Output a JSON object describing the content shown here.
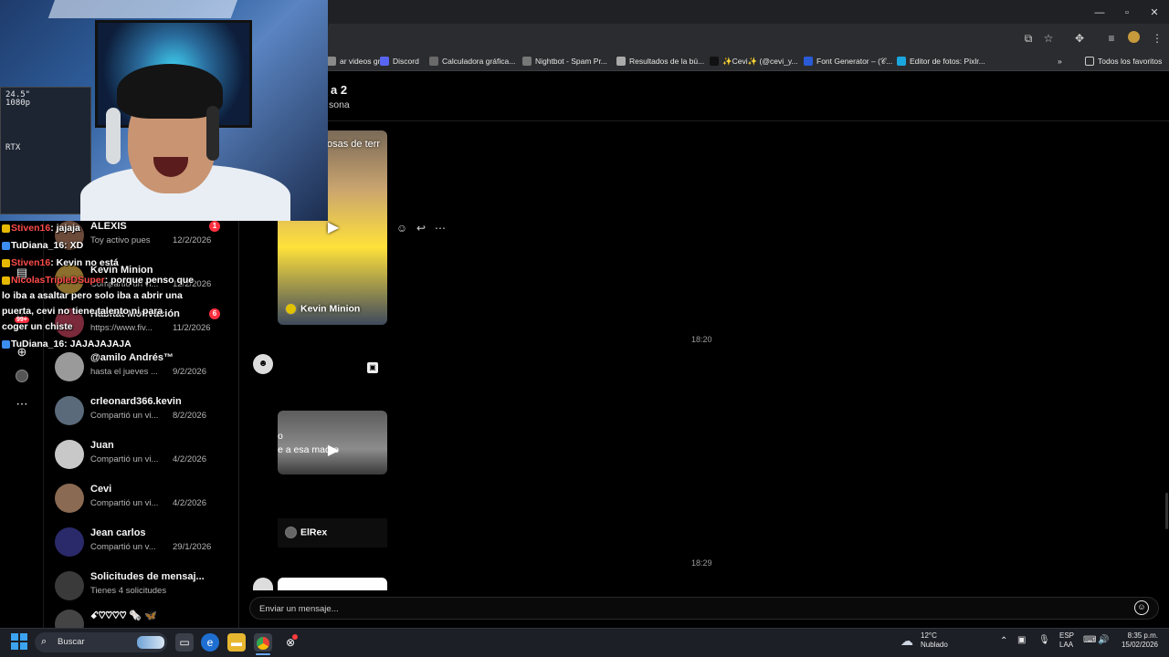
{
  "browser": {
    "window_controls": {
      "minimize": "—",
      "maximize": "▫",
      "close": "✕"
    },
    "bookmarks": [
      {
        "label": "ar videos gr...",
        "icon": "bookmark-icon",
        "color": "#8a8a8a"
      },
      {
        "label": "Discord",
        "icon": "discord-icon",
        "color": "#5865f2"
      },
      {
        "label": "Calculadora gráfica...",
        "icon": "desmos-icon",
        "color": "#6a6a6a"
      },
      {
        "label": "Nightbot - Spam Pr...",
        "icon": "nightbot-icon",
        "color": "#777777"
      },
      {
        "label": "Resultados de la bú...",
        "icon": "doc-icon",
        "color": "#aaaaaa"
      },
      {
        "label": "✨Cevi✨ (@cevi_y...",
        "icon": "tiktok-icon",
        "color": "#111111"
      },
      {
        "label": "Font Generator – (𝒞...",
        "icon": "font-icon",
        "color": "#2a5bd7"
      },
      {
        "label": "Editor de fotos: Pixlr...",
        "icon": "pixlr-icon",
        "color": "#1aa7e0"
      }
    ],
    "overflow": "»",
    "all_bookmarks": "Todos los favoritos"
  },
  "stream_chat": [
    {
      "user": "Stiven16",
      "text": ": jajaja"
    },
    {
      "user": "TuDiana_16",
      "text": ": XD"
    },
    {
      "user": "Stiven16",
      "text": ": Kevin no está"
    },
    {
      "user": "NicolasTripleDSuper",
      "text": ": porque penso que"
    },
    {
      "user": "",
      "text": "lo iba a asaltar pero solo iba a abrir una"
    },
    {
      "user": "",
      "text": "puerta, cevi no tiene talento ni para"
    },
    {
      "user": "",
      "text": "coger un chiste"
    },
    {
      "user": "TuDiana_16",
      "text": ": JAJAJAJAJA"
    }
  ],
  "webcam": {
    "readout_line1": "24.5\"",
    "readout_line2": "1080p",
    "gpu": "RTX"
  },
  "chat_list": [
    {
      "name": "ALEXIS",
      "preview": "Toy activo pues",
      "date": "12/2/2026",
      "unread": "1",
      "avatar_color": "#6b4a3a"
    },
    {
      "name": "Kevin Minion",
      "preview": "Compartió un vi...",
      "date": "12/2/2026",
      "unread": "",
      "avatar_color": "#8c6f2c"
    },
    {
      "name": "Hábitat Motivación",
      "preview": "https://www.fiv...",
      "date": "11/2/2026",
      "unread": "6",
      "avatar_color": "#7a2a3a"
    },
    {
      "name": "@amilo Andrés™",
      "preview": "hasta el jueves ...",
      "date": "9/2/2026",
      "unread": "",
      "avatar_color": "#9a9a9a"
    },
    {
      "name": "crleonard366.kevin",
      "preview": "Compartió un vi...",
      "date": "8/2/2026",
      "unread": "",
      "avatar_color": "#5a6a7a"
    },
    {
      "name": "Juan",
      "preview": "Compartió un vi...",
      "date": "4/2/2026",
      "unread": "",
      "avatar_color": "#c8c8c8"
    },
    {
      "name": "Cevi",
      "preview": "Compartió un vi...",
      "date": "4/2/2026",
      "unread": "",
      "avatar_color": "#8a6a52"
    },
    {
      "name": "Jean carlos",
      "preview": "Compartió un v...",
      "date": "29/1/2026",
      "unread": "",
      "avatar_color": "#2a2a6a"
    },
    {
      "name": "Solicitudes de mensaj...",
      "preview": "Tienes 4 solicitudes",
      "date": "",
      "unread": "",
      "avatar_color": "#3a3a3a"
    },
    {
      "name": "ꗃ♡♡♡♡ 🗞️ 🦋",
      "preview": "",
      "date": "",
      "unread": "",
      "avatar_color": "#444444"
    }
  ],
  "nav_badge": "99+",
  "conversation": {
    "title": "a 2",
    "subtitle": "sona",
    "messages": {
      "reel1_caption": "osas de terr",
      "reel1_author": "Kevin Minion",
      "time1": "18:20",
      "reel2_caption_line1": "o",
      "reel2_caption_line2": "e a esa madre",
      "reel2_author": "ElRex",
      "time2": "18:29"
    },
    "composer_placeholder": "Enviar un mensaje..."
  },
  "taskbar": {
    "search": "Buscar",
    "weather_temp": "12°C",
    "weather_desc": "Nublado",
    "lang1": "ESP",
    "lang2": "LAA",
    "time": "8:35 p.m.",
    "date": "15/02/2026"
  }
}
